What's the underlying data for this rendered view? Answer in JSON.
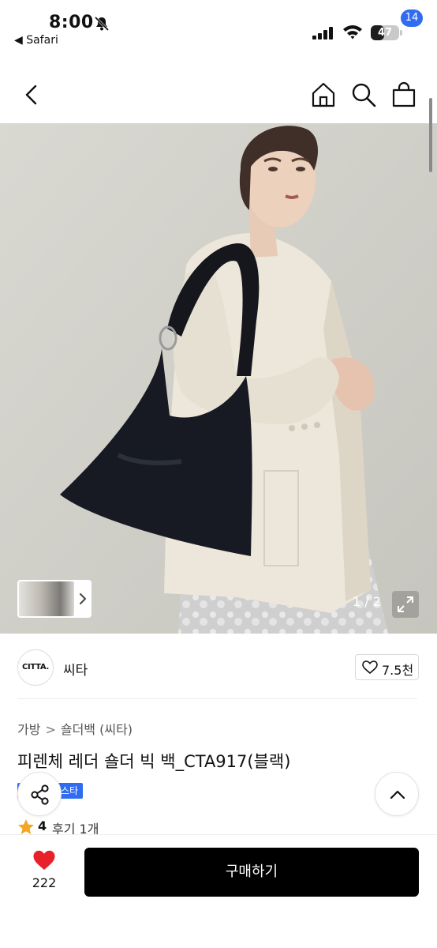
{
  "status_bar": {
    "time": "8:00",
    "back_app": "◀ Safari",
    "battery": "47",
    "battery_level": 0.47
  },
  "nav": {
    "cart_count": "14"
  },
  "gallery": {
    "counter": "1 / 2"
  },
  "brand": {
    "logo_text": "CITTA.",
    "name": "씨타",
    "likes": "7.5천"
  },
  "product": {
    "breadcrumb": [
      "가방",
      "숄더백 (씨타)"
    ],
    "breadcrumb_separator": ">",
    "title": "피렌체 레더 숄더 빅 백_CTA917(블랙)",
    "tag": "스타",
    "rating": "4",
    "reviews": "후기 1개"
  },
  "bottom_bar": {
    "wish_count": "222",
    "buy_label": "구매하기"
  },
  "colors": {
    "accent": "#2f6cf2",
    "heart": "#e8202a",
    "star": "#f5a623",
    "buy_button": "#000000"
  }
}
